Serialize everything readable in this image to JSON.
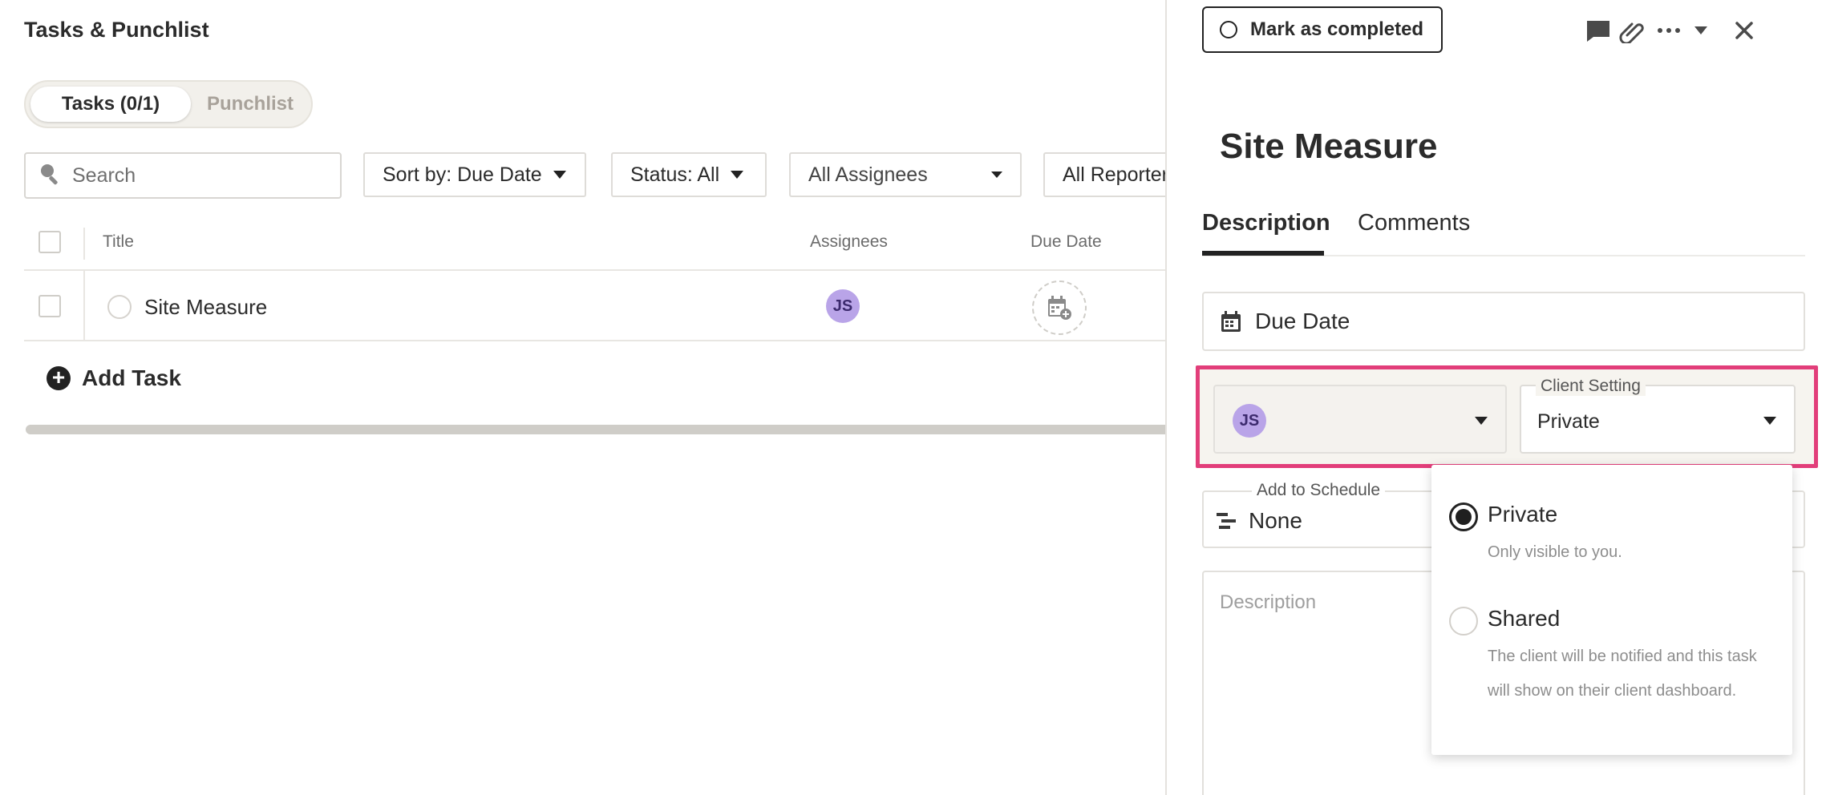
{
  "page": {
    "title": "Tasks & Punchlist",
    "tabs": [
      "Tasks (0/1)",
      "Punchlist"
    ]
  },
  "filters": {
    "search_placeholder": "Search",
    "sort": "Sort by: Due Date",
    "status": "Status: All",
    "assignees": "All Assignees",
    "reporters": "All Reporter"
  },
  "table": {
    "columns": [
      "Title",
      "Assignees",
      "Due Date"
    ],
    "rows": [
      {
        "title": "Site Measure",
        "assignee_initials": "JS"
      }
    ],
    "add_task": "Add Task"
  },
  "panel": {
    "mark_completed": "Mark as completed",
    "title": "Site Measure",
    "tabs": [
      "Description",
      "Comments"
    ],
    "due_date": "Due Date",
    "assignee_initials": "JS",
    "client_setting_label": "Client Setting",
    "client_setting_value": "Private",
    "schedule_label": "Add to Schedule",
    "schedule_value": "None",
    "description_placeholder": "Description"
  },
  "dropdown": {
    "options": [
      {
        "title": "Private",
        "desc": "Only visible to you.",
        "selected": true
      },
      {
        "title": "Shared",
        "desc": "The client will be notified and this task will show on their client dashboard.",
        "selected": false
      }
    ]
  },
  "colors": {
    "highlight": "#e23e7a",
    "avatar": "#b9a4e8"
  },
  "icons": [
    "search-icon",
    "calendar-add-icon",
    "plus-circle-icon",
    "comment-icon",
    "paperclip-icon",
    "more-icon",
    "close-icon",
    "calendar-icon",
    "schedule-icon"
  ]
}
